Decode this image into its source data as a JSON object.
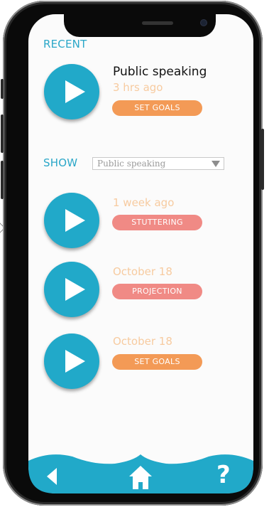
{
  "recent": {
    "heading": "RECENT",
    "item": {
      "title": "Public speaking",
      "time": "3 hrs ago",
      "tag": "SET GOALS"
    }
  },
  "show": {
    "label": "SHOW",
    "selected": "Public speaking"
  },
  "list": [
    {
      "time": "1 week ago",
      "tag": "STUTTERING",
      "tag_color": "#f08a85"
    },
    {
      "time": "October 18",
      "tag": "PROJECTION",
      "tag_color": "#f08a85"
    },
    {
      "time": "October 18",
      "tag": "SET GOALS",
      "tag_color": "#f39a56"
    }
  ],
  "colors": {
    "accent": "#21a9c9",
    "orange": "#f39a56",
    "pink": "#f08a85",
    "time_text": "#f7cba0"
  },
  "bottom_nav": {
    "back_icon": "back-icon",
    "home_icon": "home-icon",
    "help_label": "?"
  }
}
